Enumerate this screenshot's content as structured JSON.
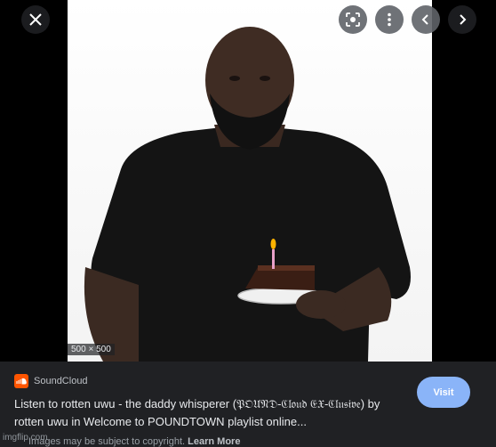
{
  "toolbar": {
    "close_icon": "close-icon",
    "lens_icon": "google-lens-icon",
    "more_icon": "more-vert-icon",
    "prev_icon": "chevron-left-icon",
    "next_icon": "chevron-right-icon"
  },
  "image": {
    "dimensions": "500 × 500"
  },
  "result": {
    "source_name": "SoundCloud",
    "source_icon": "soundcloud-icon",
    "title": "Listen to rotten uwu - the daddy whisperer (𝔓𝔒𝔘𝔑𝔇-ℭ𝔩𝔬𝔲𝔡 𝔈𝔛-ℭ𝔩𝔲𝔰𝔦𝔳𝔢) by rotten uwu in Welcome to POUNDTOWN playlist online...",
    "visit_label": "Visit",
    "copyright_text": "Images may be subject to copyright.",
    "learn_more": "Learn More"
  },
  "watermark": "imgflip.com",
  "colors": {
    "panel_bg": "#202124",
    "visit_button": "#8ab4f8",
    "soundcloud_brand": "#ff5500"
  }
}
